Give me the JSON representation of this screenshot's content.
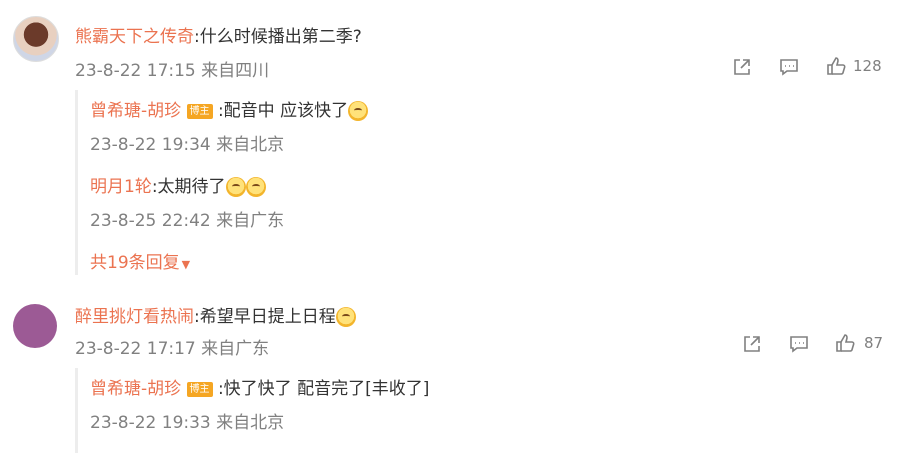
{
  "comments": [
    {
      "user": "熊霸天下之传奇",
      "text": ":什么时候播出第二季?",
      "date": "23-8-22 17:15 来自四川",
      "likes": "128",
      "replies": [
        {
          "user": "曾希瑭-胡珍",
          "badge": "博主",
          "text": ":配音中  应该快了",
          "date": "23-8-22 19:34 来自北京"
        },
        {
          "user": "明月1轮",
          "text": ":太期待了",
          "date": "23-8-25 22:42 来自广东"
        }
      ],
      "more_replies": "共19条回复"
    },
    {
      "user": "醉里挑灯看热闹",
      "text": ":希望早日提上日程",
      "date": "23-8-22 17:17 来自广东",
      "likes": "87",
      "replies": [
        {
          "user": "曾希瑭-胡珍",
          "badge": "博主",
          "text": ":快了快了 配音完了[丰收了]",
          "date": "23-8-22 19:33 来自北京"
        }
      ]
    }
  ],
  "icons": {
    "share": "share-icon",
    "comment": "comment-icon",
    "like": "thumbs-up-icon"
  },
  "colors": {
    "username": "#eb7350",
    "meta": "#808080",
    "badge": "#f5a623"
  }
}
